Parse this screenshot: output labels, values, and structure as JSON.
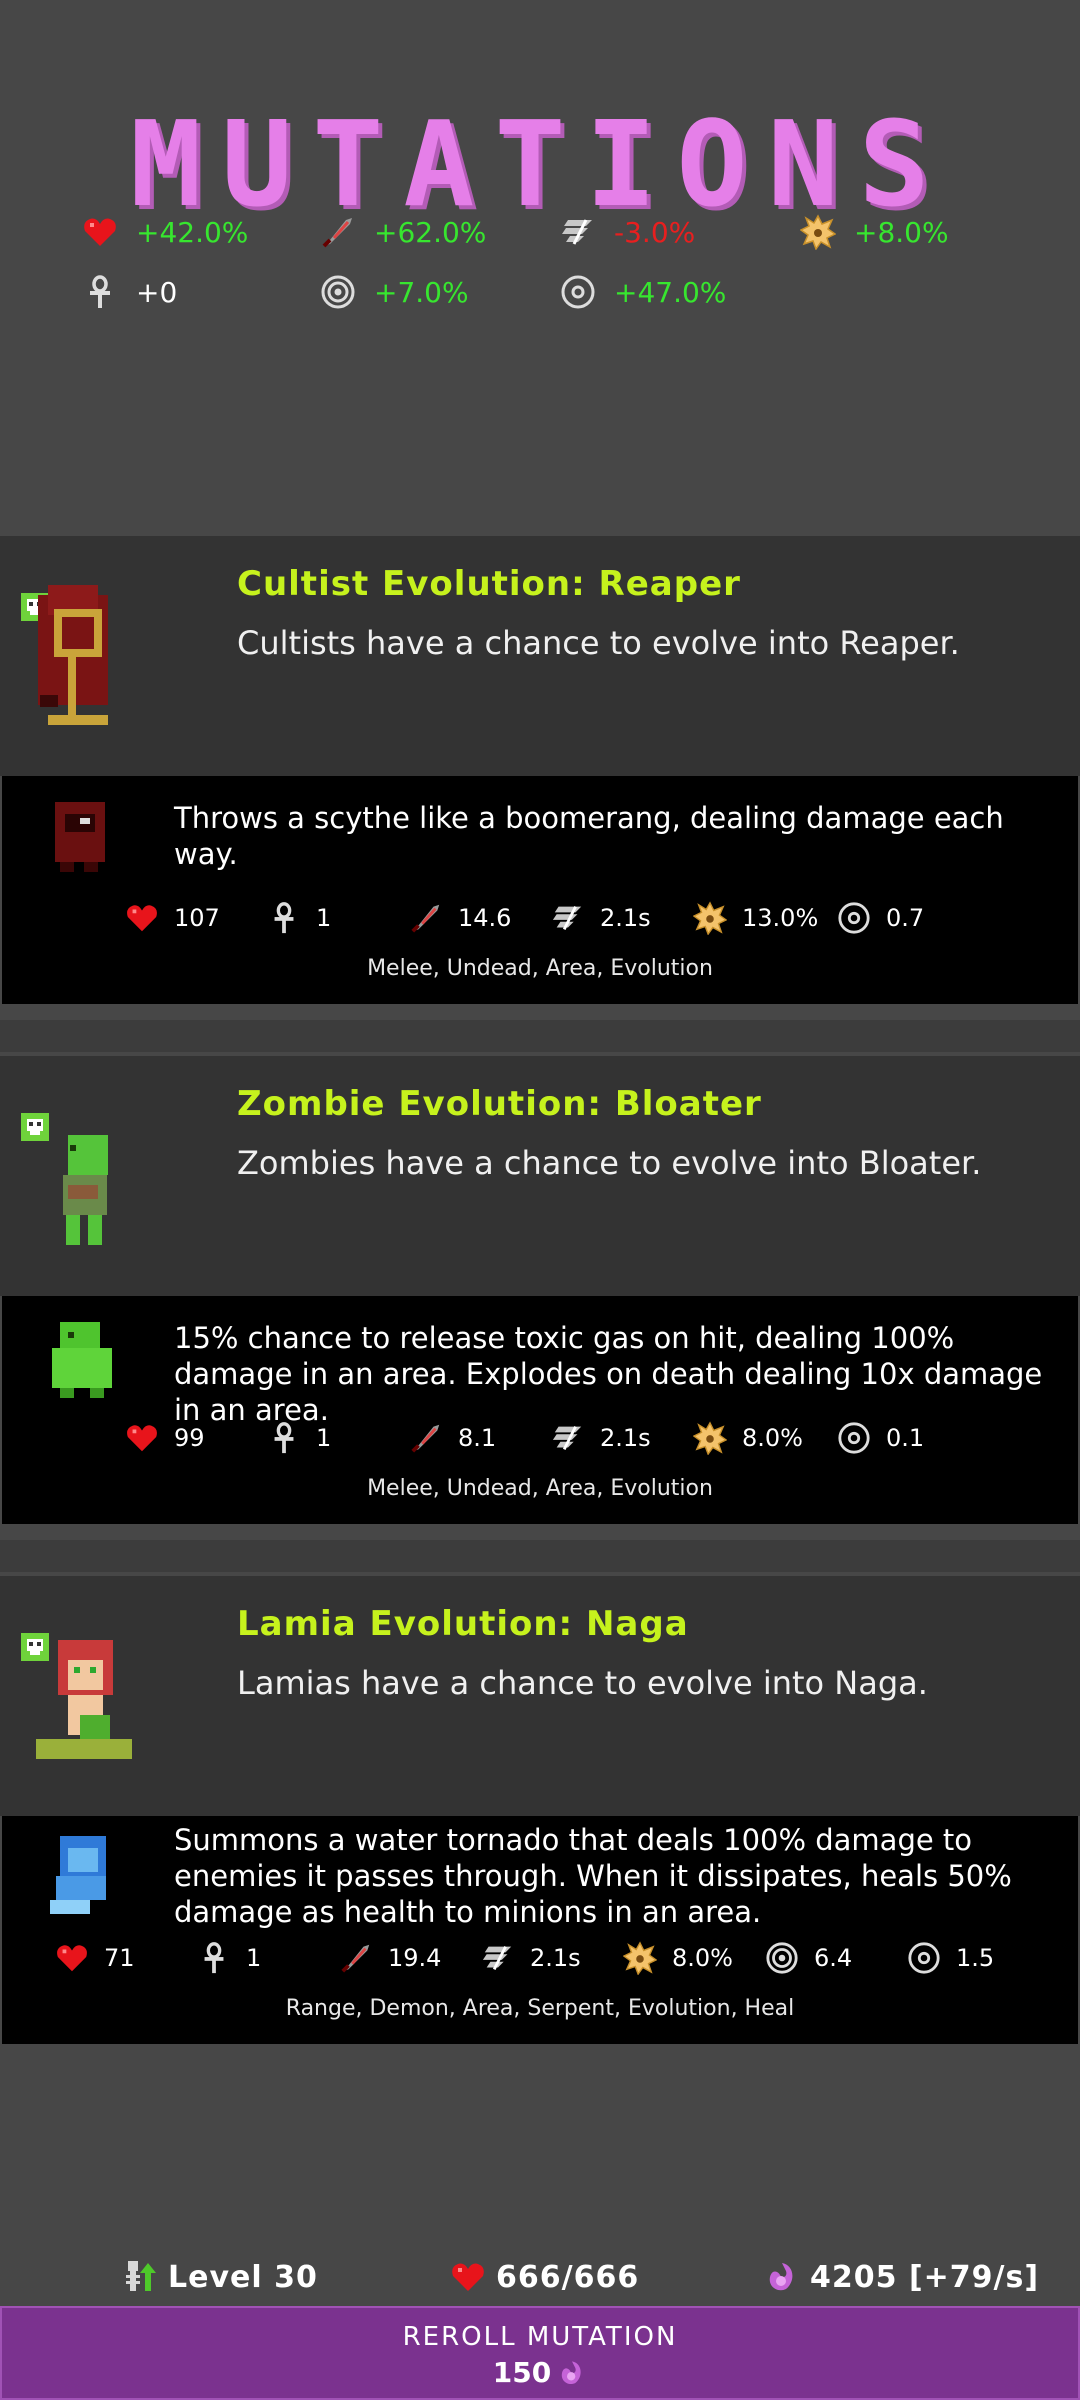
{
  "screen": {
    "title": "MUTATIONS",
    "global_stats": [
      {
        "icon": "heart-icon",
        "value": "+42.0%",
        "tone": "pos"
      },
      {
        "icon": "sword-icon",
        "value": "+62.0%",
        "tone": "pos"
      },
      {
        "icon": "speed-icon",
        "value": "-3.0%",
        "tone": "neg"
      },
      {
        "icon": "crit-burst-icon",
        "value": "+8.0%",
        "tone": "pos"
      },
      {
        "icon": "ankh-icon",
        "value": "+0",
        "tone": "neu"
      },
      {
        "icon": "target-icon",
        "value": "+7.0%",
        "tone": "pos"
      },
      {
        "icon": "range-icon",
        "value": "+47.0%",
        "tone": "pos"
      }
    ]
  },
  "mutations": [
    {
      "title": "Cultist Evolution: Reaper",
      "description": "Cultists have a chance to evolve into Reaper.",
      "minion_description": "Throws a scythe like a boomerang, dealing damage each way.",
      "stats": {
        "health": "107",
        "revives": "1",
        "damage": "14.6",
        "speed": "2.1s",
        "crit": "13.0%",
        "range": "0.7"
      },
      "tags": "Melee, Undead, Area, Evolution"
    },
    {
      "title": "Zombie Evolution: Bloater",
      "description": "Zombies have a chance to evolve into Bloater.",
      "minion_description": "15% chance to release toxic gas on hit, dealing 100% damage in an area. Explodes on death dealing 10x damage in an area.",
      "stats": {
        "health": "99",
        "revives": "1",
        "damage": "8.1",
        "speed": "2.1s",
        "crit": "8.0%",
        "range": "0.1"
      },
      "tags": "Melee, Undead, Area, Evolution"
    },
    {
      "title": "Lamia Evolution: Naga",
      "description": "Lamias have a chance to evolve into Naga.",
      "minion_description": "Summons a water tornado that deals 100% damage to enemies it passes through. When it dissipates, heals 50% damage as health to minions in an area.",
      "stats": {
        "health": "71",
        "revives": "1",
        "damage": "19.4",
        "speed": "2.1s",
        "crit": "8.0%",
        "armor": "6.4",
        "range": "1.5"
      },
      "tags": "Range, Demon, Area, Serpent, Evolution, Heal"
    }
  ],
  "footer": {
    "level": "Level 30",
    "health": "666/666",
    "souls": "4205 [+79/s]",
    "reroll_label": "REROLL MUTATION",
    "reroll_cost": "150"
  },
  "colors": {
    "title": "#e57fe8",
    "evolution_title": "#c6f21d",
    "positive": "#37e62f",
    "negative": "#e81f1f",
    "reroll_button": "#7b328f"
  }
}
